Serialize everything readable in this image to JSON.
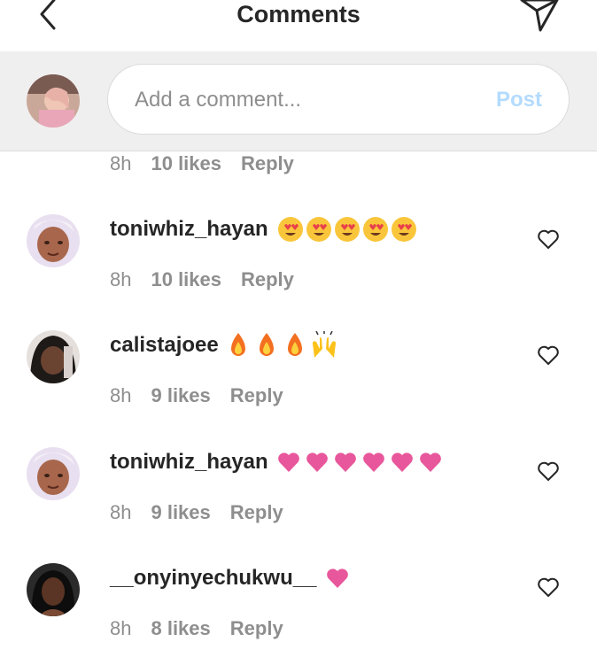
{
  "header": {
    "title": "Comments",
    "back_icon": "chevron-left-icon",
    "send_icon": "paper-plane-icon"
  },
  "composer": {
    "placeholder": "Add a comment...",
    "post_label": "Post",
    "post_color": "#b3dbff"
  },
  "partial_comment": {
    "time": "8h",
    "likes": "10 likes",
    "reply": "Reply"
  },
  "comments": [
    {
      "username": "toniwhiz_hayan",
      "emoji": "heart-eyes-emoji x5",
      "time": "8h",
      "likes": "10 likes",
      "reply": "Reply"
    },
    {
      "username": "calistajoee",
      "emoji": "fire-emoji x3 raised-hands-emoji",
      "time": "8h",
      "likes": "9 likes",
      "reply": "Reply"
    },
    {
      "username": "toniwhiz_hayan",
      "emoji": "pink-heart-emoji x6",
      "time": "8h",
      "likes": "9 likes",
      "reply": "Reply"
    },
    {
      "username": "__onyinyechukwu__",
      "emoji": "pink-heart-emoji",
      "time": "8h",
      "likes": "8 likes",
      "reply": "Reply"
    }
  ],
  "colors": {
    "text": "#262626",
    "secondary": "#8e8e8e",
    "heart_pink": "#e8579b",
    "emoji_yellow": "#f9c63b",
    "fire_orange": "#f37021"
  }
}
